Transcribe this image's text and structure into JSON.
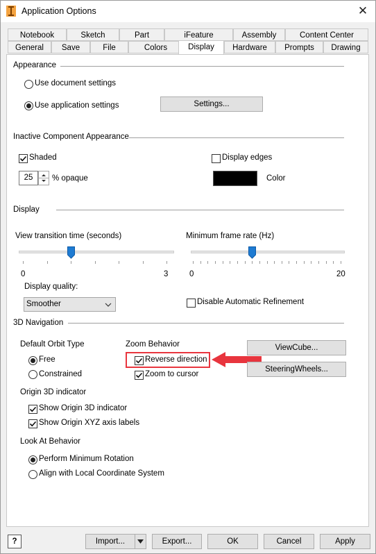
{
  "window": {
    "title": "Application Options",
    "close_glyph": "✕"
  },
  "tabs_row1": [
    "Notebook",
    "Sketch",
    "Part",
    "iFeature",
    "Assembly",
    "Content Center"
  ],
  "tabs_row2": [
    "General",
    "Save",
    "File",
    "Colors",
    "Display",
    "Hardware",
    "Prompts",
    "Drawing"
  ],
  "active_tab": "Display",
  "appearance": {
    "title": "Appearance",
    "use_document": "Use document settings",
    "use_application": "Use application settings",
    "selected": "use_application",
    "settings_button": "Settings..."
  },
  "inactive": {
    "title": "Inactive Component Appearance",
    "shaded": "Shaded",
    "shaded_checked": true,
    "opacity_value": "25",
    "opacity_label": "% opaque",
    "display_edges": "Display edges",
    "display_edges_checked": false,
    "color_label": "Color",
    "color_value": "#000000"
  },
  "display": {
    "title": "Display",
    "view_transition_label": "View transition time (seconds)",
    "view_transition_min": "0",
    "view_transition_max": "3",
    "view_transition_value": 1,
    "frame_rate_label": "Minimum frame rate (Hz)",
    "frame_rate_min": "0",
    "frame_rate_max": "20",
    "frame_rate_value": 8,
    "quality_label": "Display quality:",
    "quality_value": "Smoother",
    "disable_refinement": "Disable Automatic Refinement",
    "disable_refinement_checked": false
  },
  "nav3d": {
    "title": "3D Navigation",
    "orbit_title": "Default Orbit Type",
    "orbit_free": "Free",
    "orbit_constrained": "Constrained",
    "orbit_selected": "free",
    "zoom_title": "Zoom Behavior",
    "reverse_direction": "Reverse direction",
    "reverse_checked": true,
    "zoom_to_cursor": "Zoom to cursor",
    "zoom_to_cursor_checked": true,
    "viewcube_button": "ViewCube...",
    "steeringwheels_button": "SteeringWheels...",
    "origin_title": "Origin 3D indicator",
    "show_origin": "Show Origin 3D indicator",
    "show_origin_checked": true,
    "show_xyz": "Show Origin XYZ axis labels",
    "show_xyz_checked": true,
    "lookat_title": "Look At Behavior",
    "perform_min": "Perform Minimum Rotation",
    "align_local": "Align with Local Coordinate System",
    "lookat_selected": "perform_min"
  },
  "annotation": {
    "arrow_color": "#e8353e"
  },
  "bottom": {
    "help_glyph": "?",
    "import": "Import...",
    "export": "Export...",
    "ok": "OK",
    "cancel": "Cancel",
    "apply": "Apply"
  }
}
